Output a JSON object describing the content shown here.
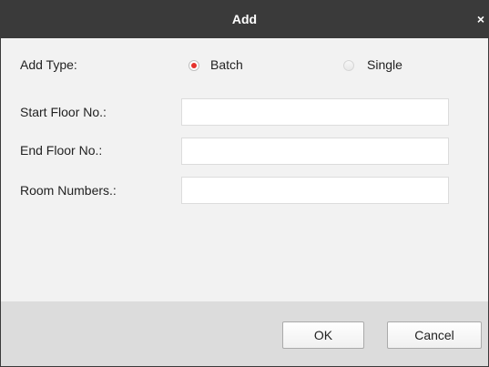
{
  "dialog": {
    "title": "Add",
    "close_glyph": "×"
  },
  "form": {
    "add_type_label": "Add Type:",
    "add_type_options": [
      {
        "label": "Batch",
        "selected": true
      },
      {
        "label": "Single",
        "selected": false
      }
    ],
    "start_floor_label": "Start Floor No.:",
    "start_floor_value": "",
    "end_floor_label": "End Floor No.:",
    "end_floor_value": "",
    "room_numbers_label": "Room Numbers.:",
    "room_numbers_value": ""
  },
  "footer": {
    "ok_label": "OK",
    "cancel_label": "Cancel"
  },
  "colors": {
    "titlebar": "#3a3a3a",
    "radio_selected": "#e5322d",
    "body": "#f2f2f2",
    "footer": "#dcdcdc"
  }
}
